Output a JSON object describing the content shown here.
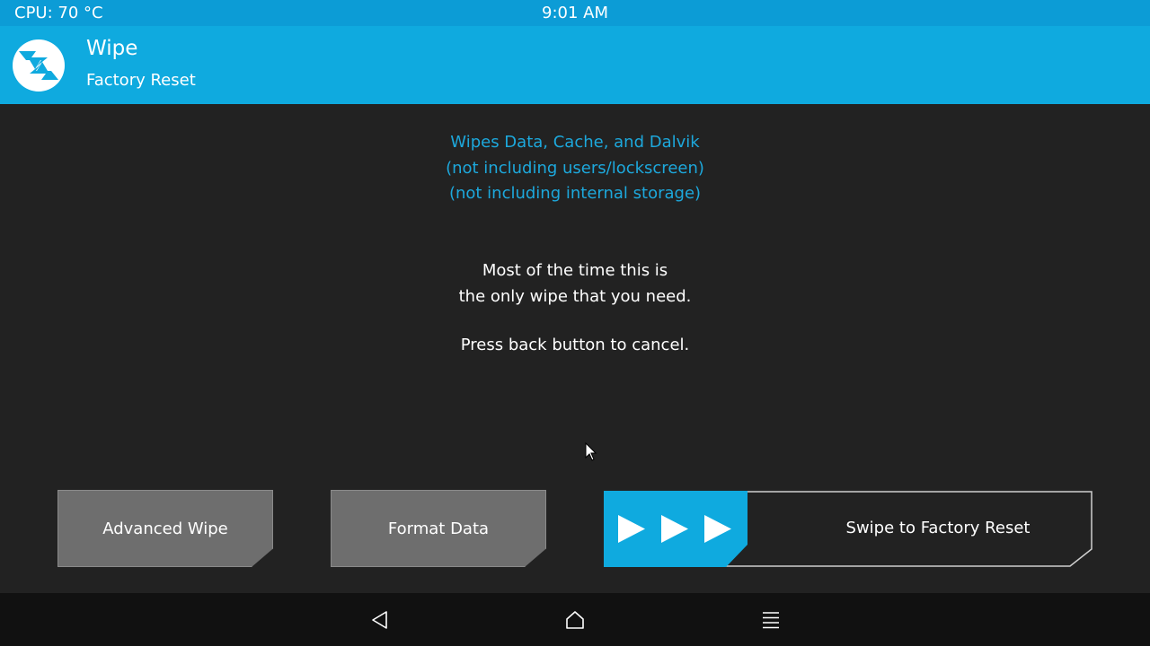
{
  "status_bar": {
    "cpu": "CPU: 70 °C",
    "time": "9:01 AM"
  },
  "header": {
    "logo_icon": "twrp-logo-icon",
    "title": "Wipe",
    "subtitle": "Factory Reset"
  },
  "info": {
    "line1": "Wipes Data, Cache, and Dalvik",
    "line2": "(not including users/lockscreen)",
    "line3": "(not including internal storage)"
  },
  "description": {
    "line1": "Most of the time this is",
    "line2": "the only wipe that you need.",
    "cancel_hint": "Press back button to cancel."
  },
  "buttons": {
    "advanced_wipe": "Advanced Wipe",
    "format_data": "Format Data"
  },
  "slider": {
    "label": "Swipe to Factory Reset",
    "icon": "triple-play-arrow-icon",
    "progress": 0
  },
  "nav": {
    "back_icon": "back-icon",
    "home_icon": "home-icon",
    "menu_icon": "menu-icon"
  },
  "colors": {
    "accent": "#0faadf",
    "status_bar": "#0c9cd6",
    "background": "#222222",
    "info_text": "#1da8dc",
    "button": "#6e6e6e",
    "nav_bar": "#111111"
  }
}
